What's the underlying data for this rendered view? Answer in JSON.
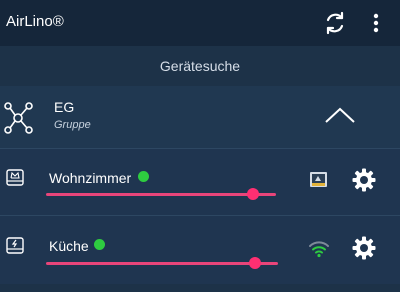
{
  "appbar": {
    "title": "AirLino®",
    "sync_icon": "sync-icon",
    "menu_icon": "more-vert-icon"
  },
  "search": {
    "label": "Gerätesuche"
  },
  "group": {
    "name": "EG",
    "subtitle": "Gruppe",
    "icon": "network-group-icon",
    "toggle_icon": "chevron-up-icon"
  },
  "devices": [
    {
      "name": "Wohnzimmer",
      "icon": "device-crown-icon",
      "status_color": "#2ecc40",
      "level": 0.9,
      "status_icon": "display-icon",
      "settings_icon": "gear-icon"
    },
    {
      "name": "Küche",
      "icon": "device-plug-icon",
      "status_color": "#2ecc40",
      "level": 0.9,
      "status_icon": "wifi-icon",
      "settings_icon": "gear-icon"
    }
  ],
  "colors": {
    "accent": "#ff2f72",
    "online": "#2ecc40",
    "background": "#1f3550",
    "appbar": "#15263a"
  }
}
